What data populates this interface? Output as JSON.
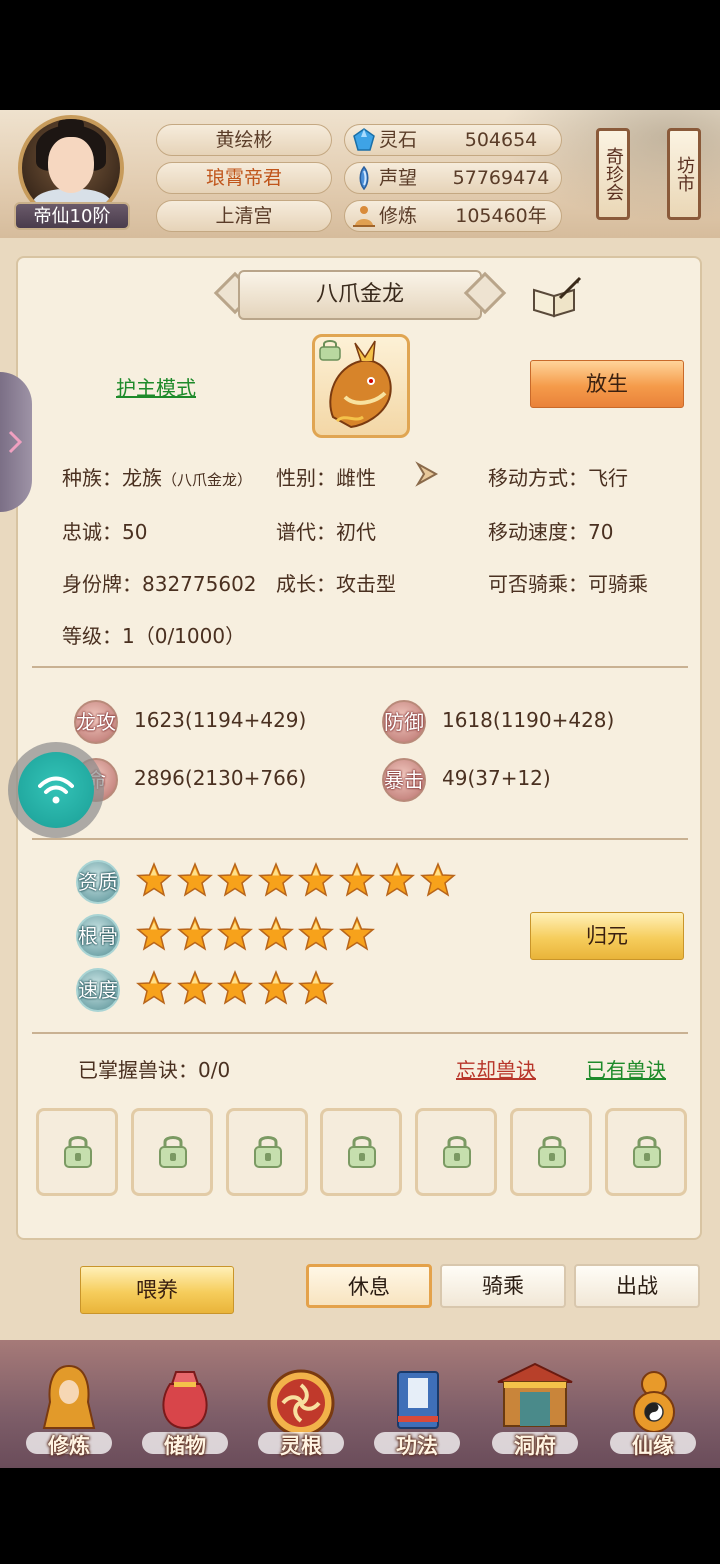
{
  "player": {
    "name": "黄绘彬",
    "title": "琅霄帝君",
    "sect": "上清宫",
    "rank": "帝仙10阶"
  },
  "resources": [
    {
      "icon": "spirit-stone-icon",
      "label": "灵石",
      "value": "504654"
    },
    {
      "icon": "reputation-icon",
      "label": "声望",
      "value": "57769474"
    },
    {
      "icon": "cultivation-icon",
      "label": "修炼",
      "value": "105460年"
    }
  ],
  "top_buttons": {
    "treasure": "奇珍会",
    "market": "坊市"
  },
  "pet": {
    "name": "八爪金龙",
    "guard_mode": "护主模式",
    "release_button": "放生",
    "reset_button": "归元",
    "info": {
      "race": "种族：龙族",
      "race_sub": "（八爪金龙）",
      "gender": "性别：雌性",
      "move_type": "移动方式：飞行",
      "loyalty": "忠诚：50",
      "generation": "谱代：初代",
      "move_speed": "移动速度：70",
      "id_tag": "身份牌：832775602",
      "growth": "成长：攻击型",
      "rideable": "可否骑乘：可骑乘",
      "level": "等级：1（0/1000）"
    },
    "stats": [
      {
        "badge": "龙攻",
        "value": "1623(1194+429)"
      },
      {
        "badge": "防御",
        "value": "1618(1190+428)"
      },
      {
        "badge": "命",
        "value": "2896(2130+766)"
      },
      {
        "badge": "暴击",
        "value": "49(37+12)"
      }
    ],
    "ratings": [
      {
        "badge": "资质",
        "stars": 8
      },
      {
        "badge": "根骨",
        "stars": 6
      },
      {
        "badge": "速度",
        "stars": 5
      }
    ],
    "skills_label": "已掌握兽诀：0/0",
    "forget_link": "忘却兽诀",
    "owned_link": "已有兽诀",
    "skill_slots": 7
  },
  "actions": {
    "feed": "喂养",
    "rest": "休息",
    "ride": "骑乘",
    "battle": "出战"
  },
  "nav": [
    {
      "label": "修炼",
      "icon": "cultivate-icon"
    },
    {
      "label": "储物",
      "icon": "storage-bag-icon"
    },
    {
      "label": "灵根",
      "icon": "spirit-root-icon"
    },
    {
      "label": "功法",
      "icon": "technique-book-icon"
    },
    {
      "label": "洞府",
      "icon": "cave-mansion-icon"
    },
    {
      "label": "仙缘",
      "icon": "fate-gourd-icon"
    }
  ],
  "colors": {
    "accent_orange": "#f59b4a",
    "accent_gold": "#f6cd5c",
    "link_green": "#1e8a2a",
    "link_red": "#b8362a",
    "star": "#f7a21b"
  }
}
